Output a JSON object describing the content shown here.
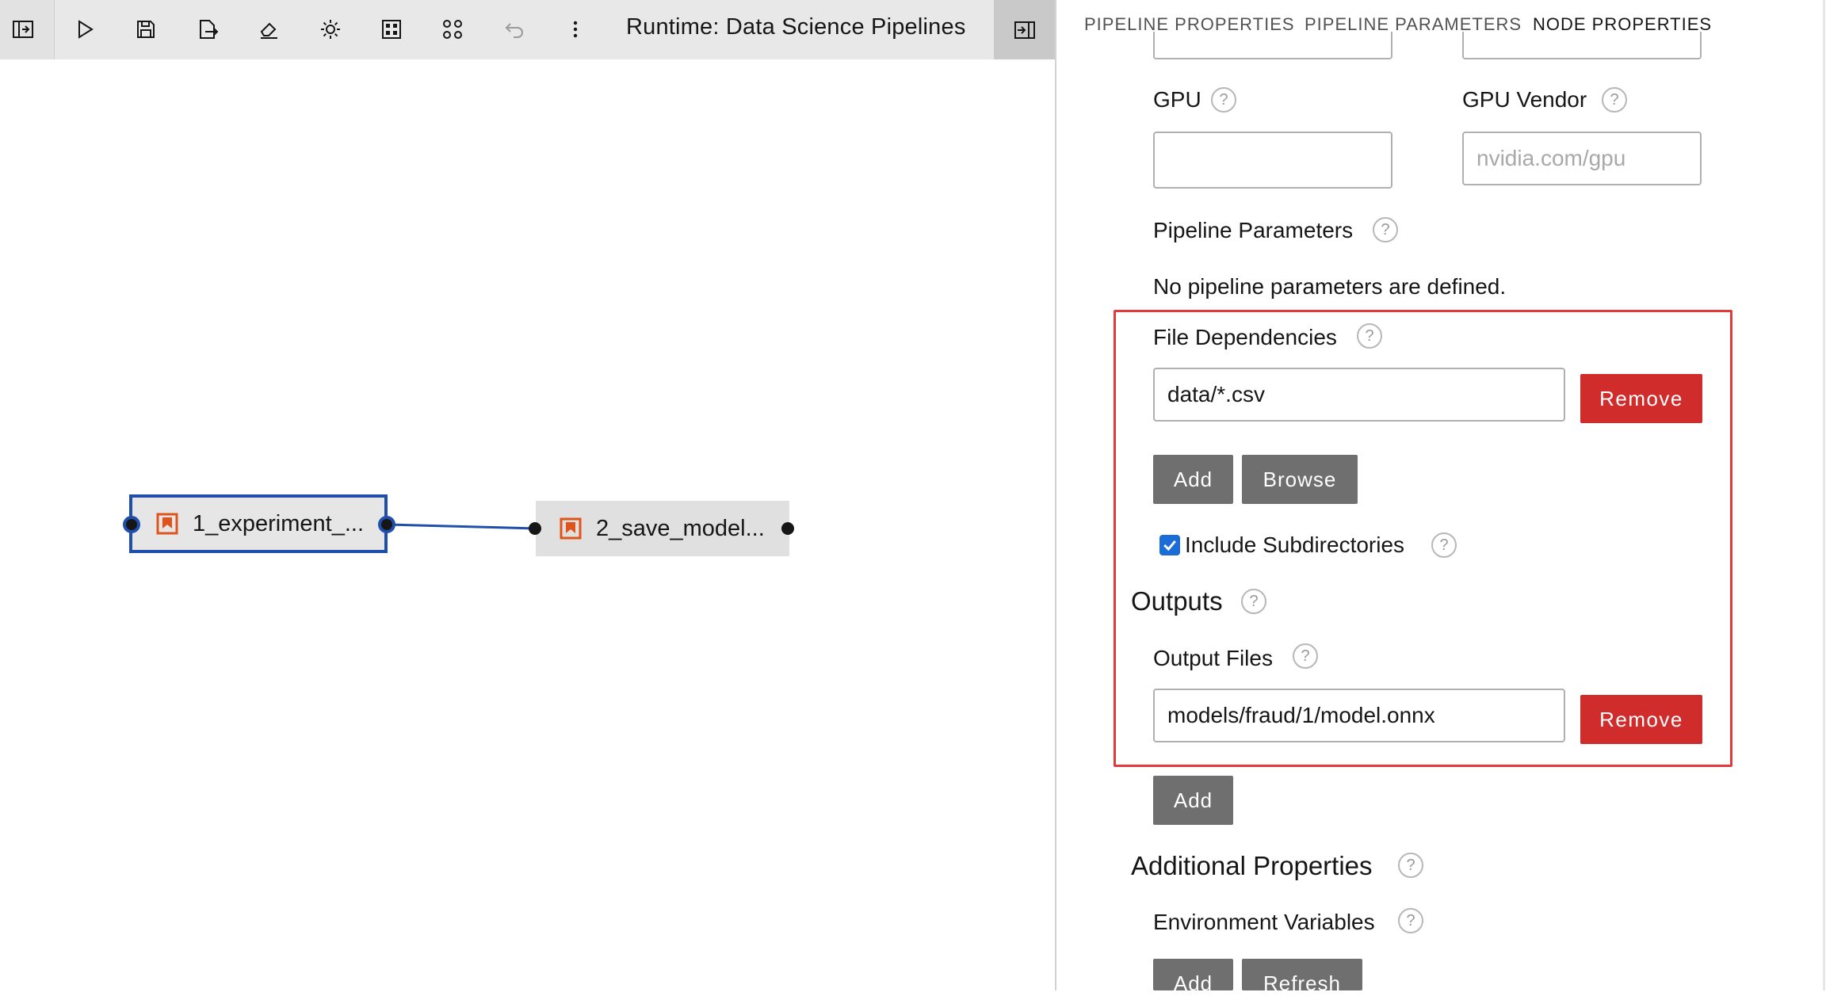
{
  "toolbar": {
    "runtime_label": "Runtime: Data Science Pipelines",
    "icons": [
      "panel-collapse-icon",
      "run-icon",
      "save-icon",
      "export-icon",
      "clear-icon",
      "settings-icon",
      "arrange-icon",
      "layout-icon",
      "undo-icon",
      "more-icon",
      "panel-toggle-icon"
    ]
  },
  "canvas": {
    "nodes": [
      {
        "label": "1_experiment_...",
        "selected": true
      },
      {
        "label": "2_save_model...",
        "selected": false
      }
    ]
  },
  "tabs": [
    {
      "label": "PIPELINE PROPERTIES",
      "active": false
    },
    {
      "label": "PIPELINE PARAMETERS",
      "active": false
    },
    {
      "label": "NODE PROPERTIES",
      "active": true
    }
  ],
  "props": {
    "gpu_label": "GPU",
    "gpu_value": "",
    "gpu_vendor_label": "GPU Vendor",
    "gpu_vendor_placeholder": "nvidia.com/gpu",
    "pipeline_params_label": "Pipeline Parameters",
    "pipeline_params_empty": "No pipeline parameters are defined.",
    "file_deps_label": "File Dependencies",
    "file_deps_value": "data/*.csv",
    "remove_label": "Remove",
    "add_label": "Add",
    "browse_label": "Browse",
    "include_subdirs_label": "Include Subdirectories",
    "include_subdirs_checked": true,
    "outputs_label": "Outputs",
    "output_files_label": "Output Files",
    "output_files_value": "models/fraud/1/model.onnx",
    "additional_props_label": "Additional Properties",
    "env_vars_label": "Environment Variables",
    "refresh_label": "Refresh",
    "help_glyph": "?"
  },
  "colors": {
    "accent_blue": "#1f4faa",
    "remove_red": "#d02c2c",
    "highlight_red": "#e03a3a",
    "button_gray": "#6f6f6f",
    "node_icon_orange": "#e0541b"
  }
}
